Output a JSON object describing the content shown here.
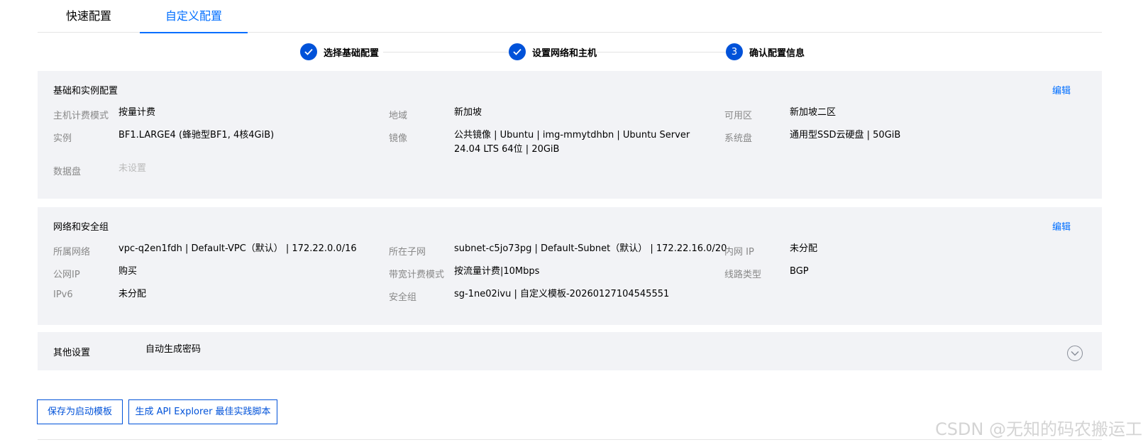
{
  "tabs": [
    {
      "label": "快速配置",
      "active": false
    },
    {
      "label": "自定义配置",
      "active": true
    }
  ],
  "steps": [
    {
      "marker": "check",
      "label": "选择基础配置"
    },
    {
      "marker": "check",
      "label": "设置网络和主机"
    },
    {
      "marker": "3",
      "label": "确认配置信息"
    }
  ],
  "basic": {
    "title": "基础和实例配置",
    "edit": "编辑",
    "fields": [
      {
        "label": "主机计费模式",
        "value": "按量计费"
      },
      {
        "label": "地域",
        "value": "新加坡"
      },
      {
        "label": "可用区",
        "value": "新加坡二区"
      },
      {
        "label": "实例",
        "value": "BF1.LARGE4 (蜂驰型BF1, 4核4GiB)"
      },
      {
        "label": "镜像",
        "value": "公共镜像 | Ubuntu | img-mmytdhbn | Ubuntu Server 24.04 LTS 64位 | 20GiB"
      },
      {
        "label": "系统盘",
        "value": "通用型SSD云硬盘 | 50GiB"
      },
      {
        "label": "数据盘",
        "value": "未设置"
      }
    ]
  },
  "network": {
    "title": "网络和安全组",
    "edit": "编辑",
    "fields": [
      {
        "label": "所属网络",
        "value": "vpc-q2en1fdh | Default-VPC（默认） | 172.22.0.0/16"
      },
      {
        "label": "所在子网",
        "value": "subnet-c5jo73pg | Default-Subnet（默认） | 172.22.16.0/20"
      },
      {
        "label": "内网 IP",
        "value": "未分配"
      },
      {
        "label": "公网IP",
        "value": "购买"
      },
      {
        "label": "带宽计费模式",
        "value": "按流量计费|10Mbps"
      },
      {
        "label": "线路类型",
        "value": "BGP"
      },
      {
        "label": "IPv6",
        "value": "未分配"
      },
      {
        "label": "安全组",
        "value": "sg-1ne02ivu | 自定义模板-20260127104545551"
      }
    ]
  },
  "other": {
    "title": "其他设置",
    "value": "自动生成密码"
  },
  "buttons": {
    "save_template": "保存为启动模板",
    "gen_script": "生成 API Explorer 最佳实践脚本"
  },
  "watermark": "CSDN @无知的码农搬运工",
  "colors": {
    "accent": "#006eff",
    "step_circle": "#0052d9",
    "panel_bg": "#f2f3f6",
    "label_gray": "#888888",
    "muted": "#bbbbbb"
  }
}
